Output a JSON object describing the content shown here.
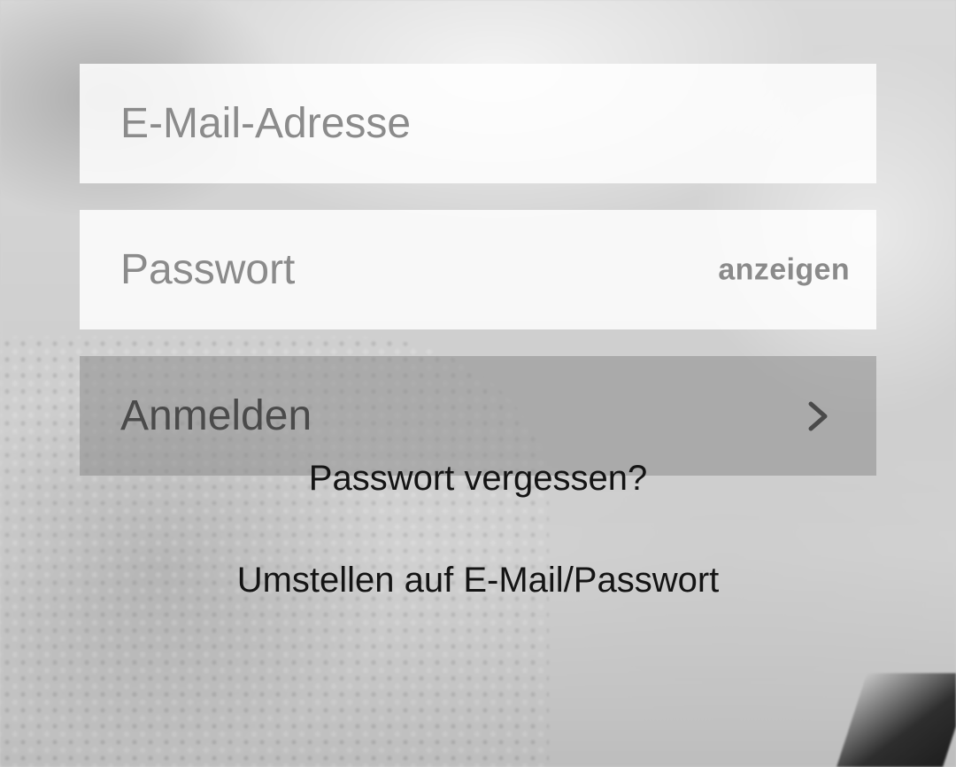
{
  "form": {
    "email_placeholder": "E-Mail-Adresse",
    "password_placeholder": "Passwort",
    "show_password_label": "anzeigen",
    "submit_label": "Anmelden"
  },
  "links": {
    "forgot_password": "Passwort vergessen?",
    "switch_mode": "Umstellen auf E-Mail/Passwort"
  },
  "icons": {
    "submit_chevron": "chevron-right-icon"
  },
  "colors": {
    "link_text": "#141414",
    "placeholder_text": "#8b8b8b",
    "button_text": "#4a4a4a"
  }
}
